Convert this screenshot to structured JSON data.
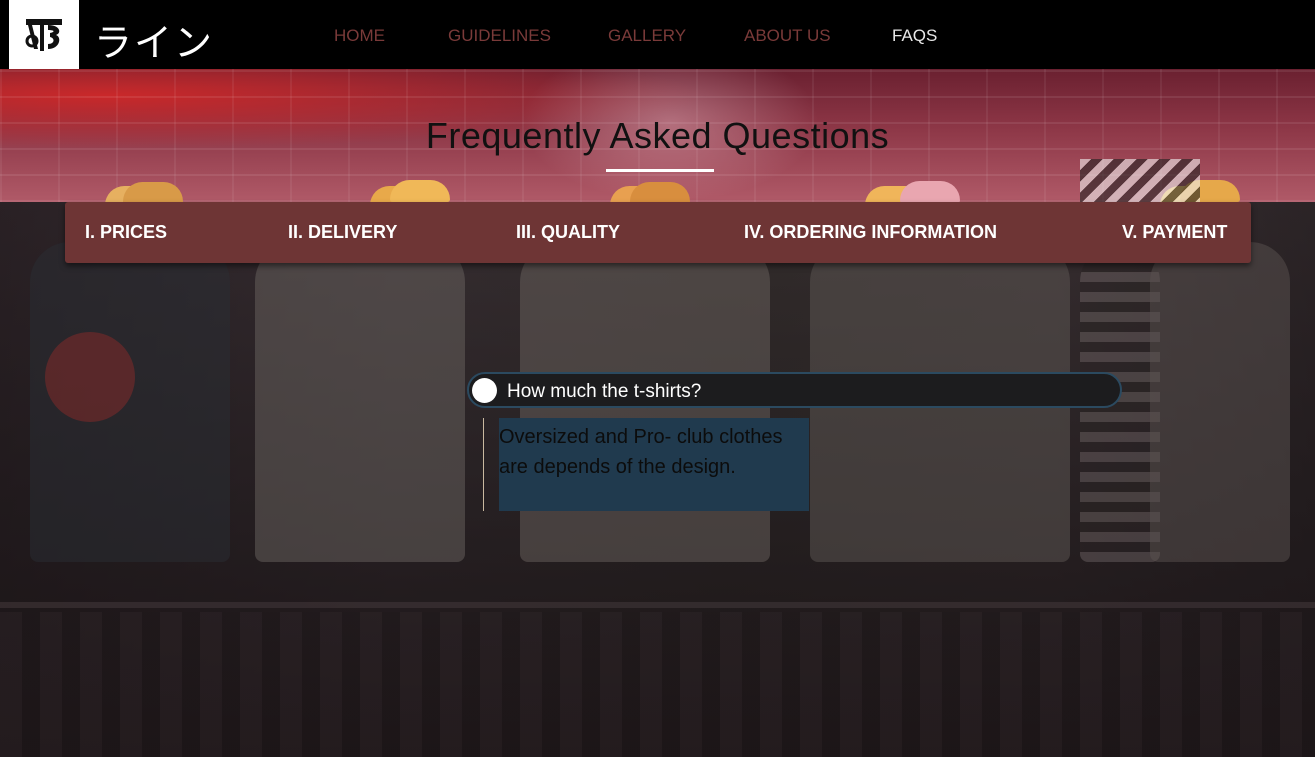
{
  "brand": {
    "logo_text": "BTC",
    "name": "ライン"
  },
  "nav": {
    "items": [
      {
        "label": "HOME"
      },
      {
        "label": "GUIDELINES"
      },
      {
        "label": "GALLERY"
      },
      {
        "label": "ABOUT US"
      },
      {
        "label": "FAQS"
      }
    ],
    "active": "FAQS"
  },
  "hero": {
    "title": "Frequently Asked Questions"
  },
  "tabs": [
    {
      "label": "I. PRICES"
    },
    {
      "label": "II. DELIVERY"
    },
    {
      "label": "III. QUALITY"
    },
    {
      "label": "IV. ORDERING INFORMATION"
    },
    {
      "label": "V. PAYMENT"
    }
  ],
  "faq": {
    "question": "How much the t-shirts?",
    "answer": "Oversized and Pro- club clothes are depends of the design."
  },
  "colors": {
    "nav_bg": "#000000",
    "nav_link": "#7a3a39",
    "nav_active": "#e8e8e8",
    "tab_bar": "#6e3535",
    "answer_bg": "#203a4e",
    "question_border": "#2b4a60"
  },
  "icons": {
    "logo": "btc-monogram-icon",
    "toggle": "toggle-circle-icon"
  }
}
